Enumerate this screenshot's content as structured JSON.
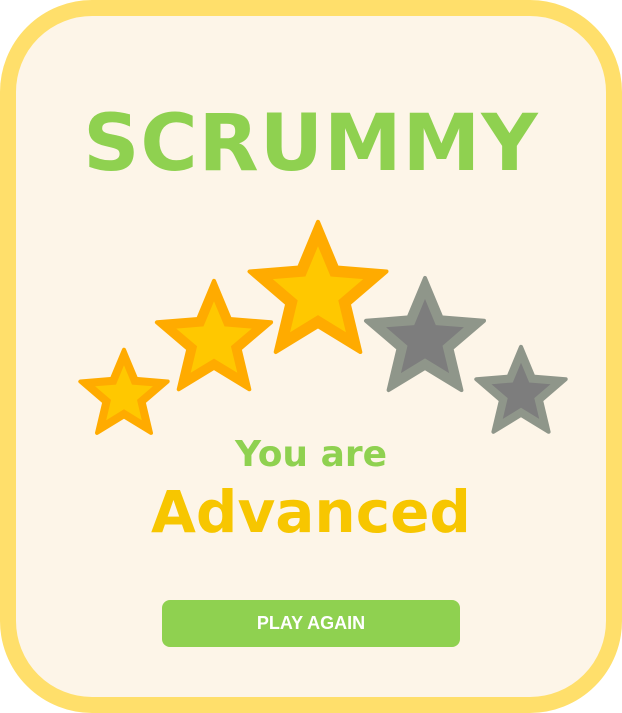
{
  "game": {
    "title": "SCRUMMY",
    "result_prefix": "You are",
    "result_level": "Advanced",
    "play_again_label": "PLAY AGAIN"
  },
  "rating": {
    "filled_stars": 3,
    "total_stars": 5
  },
  "colors": {
    "brand_green": "#8fd150",
    "level_yellow": "#f7c600",
    "card_border": "#ffdf6b",
    "card_background": "#fdf5e8",
    "star_filled": "#ffc800",
    "star_filled_border": "#ffab00",
    "star_empty": "#7d7d7d",
    "star_empty_border": "#8f968a"
  }
}
